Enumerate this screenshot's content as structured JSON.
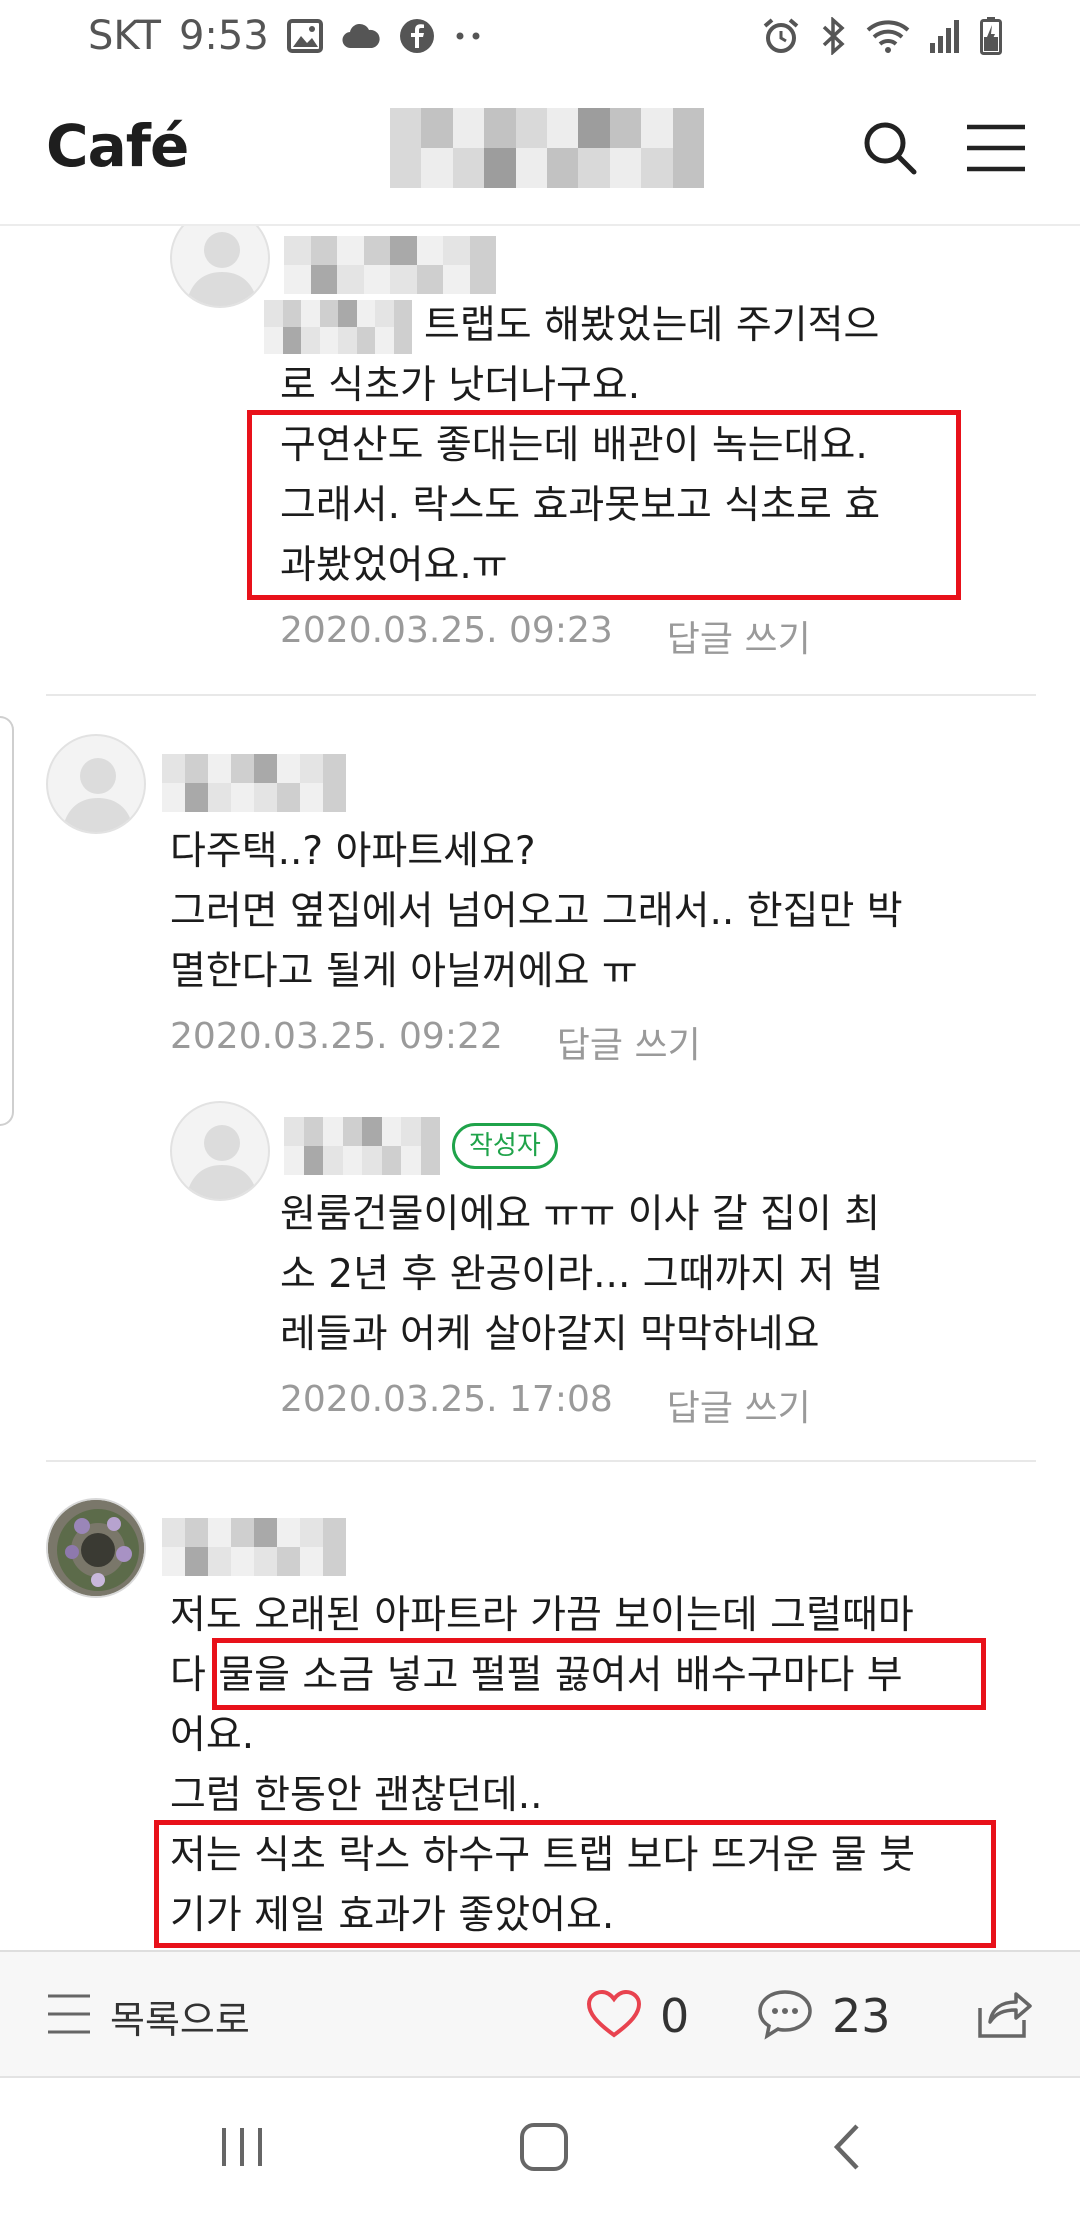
{
  "status_bar": {
    "carrier": "SKT",
    "time": "9:53",
    "left_icons": [
      "image-icon",
      "cloud-icon",
      "facebook-icon",
      "more-dots-icon"
    ],
    "right_icons": [
      "alarm-icon",
      "bluetooth-icon",
      "wifi-icon",
      "signal-icon",
      "battery-charging-icon"
    ]
  },
  "app_bar": {
    "logo": "Café",
    "search_icon": "search-icon",
    "menu_icon": "hamburger-menu-icon"
  },
  "comments": [
    {
      "kind": "reply",
      "lines": [
        "트랩도 해봤었는데 주기적으",
        "로 식초가 낫더나구요.",
        "구연산도 좋대는데 배관이 녹는대요.",
        "그래서. 락스도 효과못보고 식초로 효",
        "과봤었어요.ㅠ"
      ],
      "date": "2020.03.25. 09:23",
      "reply_label": "답글 쓰기"
    },
    {
      "kind": "comment",
      "lines": [
        "다주택..? 아파트세요?",
        "그러면 옆집에서 넘어오고 그래서.. 한집만 박",
        "멸한다고 될게 아닐꺼에요 ㅠ"
      ],
      "date": "2020.03.25. 09:22",
      "reply_label": "답글 쓰기"
    },
    {
      "kind": "reply",
      "author_badge": "작성자",
      "lines": [
        "원룸건물이에요 ㅠㅠ 이사 갈 집이 최",
        "소 2년 후 완공이라... 그때까지 저 벌",
        "레들과 어케 살아갈지 막막하네요"
      ],
      "date": "2020.03.25. 17:08",
      "reply_label": "답글 쓰기"
    },
    {
      "kind": "comment",
      "lines": [
        "저도 오래된 아파트라 가끔 보이는데 그럴때마",
        "다 물을 소금 넣고 펄펄 끓여서 배수구마다 부",
        "어요.",
        "그럼 한동안 괜찮던데..",
        "저는 식초 락스 하수구 트랩 보다 뜨거운 물 붓",
        "기가 제일 효과가 좋았어요."
      ]
    }
  ],
  "action_bar": {
    "list_label": "목록으로",
    "like_count": "0",
    "comment_count": "23",
    "share_icon": "share-icon"
  },
  "nav_bar": {
    "icons": [
      "recent-apps-icon",
      "home-icon",
      "back-icon"
    ]
  },
  "colors": {
    "highlight": "#e8111a",
    "author_badge": "#1fa34a",
    "like_heart": "#e8434f",
    "meta_text": "#9a9a9a"
  }
}
